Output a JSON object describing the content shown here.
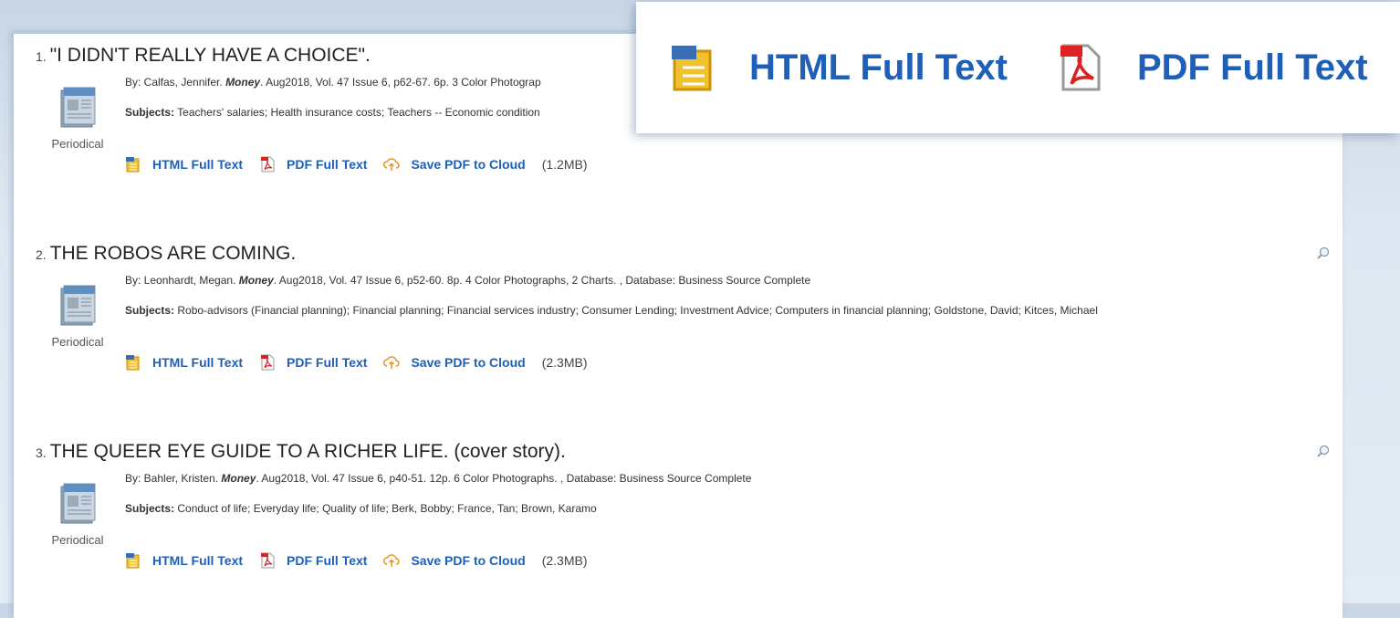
{
  "results": [
    {
      "number": "1.",
      "title": "\"I DIDN'T REALLY HAVE A CHOICE\".",
      "by_prefix": "By: Calfas, Jennifer.",
      "source": "Money",
      "details": ". Aug2018, Vol. 47 Issue 6, p62-67. 6p. 3 Color Photograp",
      "subjects_label": "Subjects:",
      "subjects": "Teachers' salaries; Health insurance costs; Teachers -- Economic condition",
      "pub_type": "Periodical",
      "html_link": "HTML Full Text",
      "pdf_link": "PDF Full Text",
      "cloud_link": "Save PDF to Cloud",
      "size": "(1.2MB)"
    },
    {
      "number": "2.",
      "title": "THE ROBOS ARE COMING.",
      "by_prefix": "By: Leonhardt, Megan.",
      "source": "Money",
      "details": ". Aug2018, Vol. 47 Issue 6, p52-60. 8p. 4 Color Photographs, 2 Charts. , Database: Business Source Complete",
      "subjects_label": "Subjects:",
      "subjects": "Robo-advisors (Financial planning); Financial planning; Financial services industry; Consumer Lending; Investment Advice; Computers in financial planning; Goldstone, David; Kitces, Michael",
      "pub_type": "Periodical",
      "html_link": "HTML Full Text",
      "pdf_link": "PDF Full Text",
      "cloud_link": "Save PDF to Cloud",
      "size": "(2.3MB)"
    },
    {
      "number": "3.",
      "title": "THE QUEER EYE GUIDE TO A RICHER LIFE. (cover story).",
      "by_prefix": "By: Bahler, Kristen.",
      "source": "Money",
      "details": ". Aug2018, Vol. 47 Issue 6, p40-51. 12p. 6 Color Photographs. , Database: Business Source Complete",
      "subjects_label": "Subjects:",
      "subjects": "Conduct of life; Everyday life; Quality of life; Berk, Bobby; France, Tan; Brown, Karamo",
      "pub_type": "Periodical",
      "html_link": "HTML Full Text",
      "pdf_link": "PDF Full Text",
      "cloud_link": "Save PDF to Cloud",
      "size": "(2.3MB)"
    }
  ],
  "zoom": {
    "html_link": "HTML Full Text",
    "pdf_link": "PDF Full Text"
  },
  "colors": {
    "link": "#1f5fb8",
    "cloud": "#e8921c",
    "pdf_red": "#d22"
  }
}
